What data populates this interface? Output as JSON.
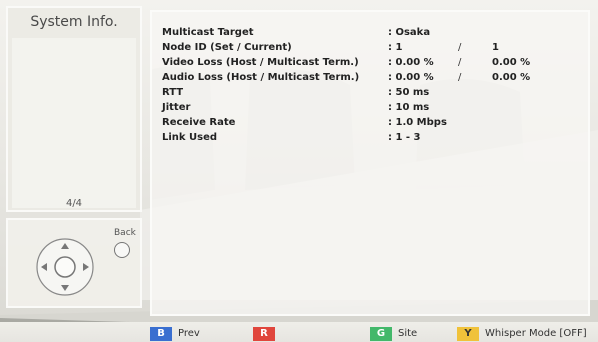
{
  "left_panel": {
    "title": "System Info.",
    "page_indicator": "4/4"
  },
  "nav_panel": {
    "back_label": "Back"
  },
  "info": {
    "rows": [
      {
        "label": "Multicast Target",
        "value": ": Osaka",
        "sep": "",
        "value2": ""
      },
      {
        "label": "Node ID (Set / Current)",
        "value": ": 1",
        "sep": "/",
        "value2": "1"
      },
      {
        "label": "Video Loss (Host / Multicast Term.)",
        "value": ": 0.00 %",
        "sep": "/",
        "value2": "0.00 %"
      },
      {
        "label": "Audio Loss (Host / Multicast Term.)",
        "value": ": 0.00 %",
        "sep": "/",
        "value2": "0.00 %"
      },
      {
        "label": "RTT",
        "value": ": 50 ms",
        "sep": "",
        "value2": ""
      },
      {
        "label": "Jitter",
        "value": ": 10 ms",
        "sep": "",
        "value2": ""
      },
      {
        "label": "Receive Rate",
        "value": ": 1.0 Mbps",
        "sep": "",
        "value2": ""
      },
      {
        "label": "Link Used",
        "value": ": 1 - 3",
        "sep": "",
        "value2": ""
      }
    ]
  },
  "footer": {
    "buttons": [
      {
        "key": "B",
        "label": "Prev",
        "color": "#3a6fd0"
      },
      {
        "key": "R",
        "label": "",
        "color": "#e0463c"
      },
      {
        "key": "G",
        "label": "Site",
        "color": "#43b86a"
      },
      {
        "key": "Y",
        "label": "Whisper Mode [OFF]",
        "color": "#f0c23a"
      }
    ]
  },
  "icons": {
    "dpad": "directional-pad-icon",
    "back": "back-circle-button"
  }
}
